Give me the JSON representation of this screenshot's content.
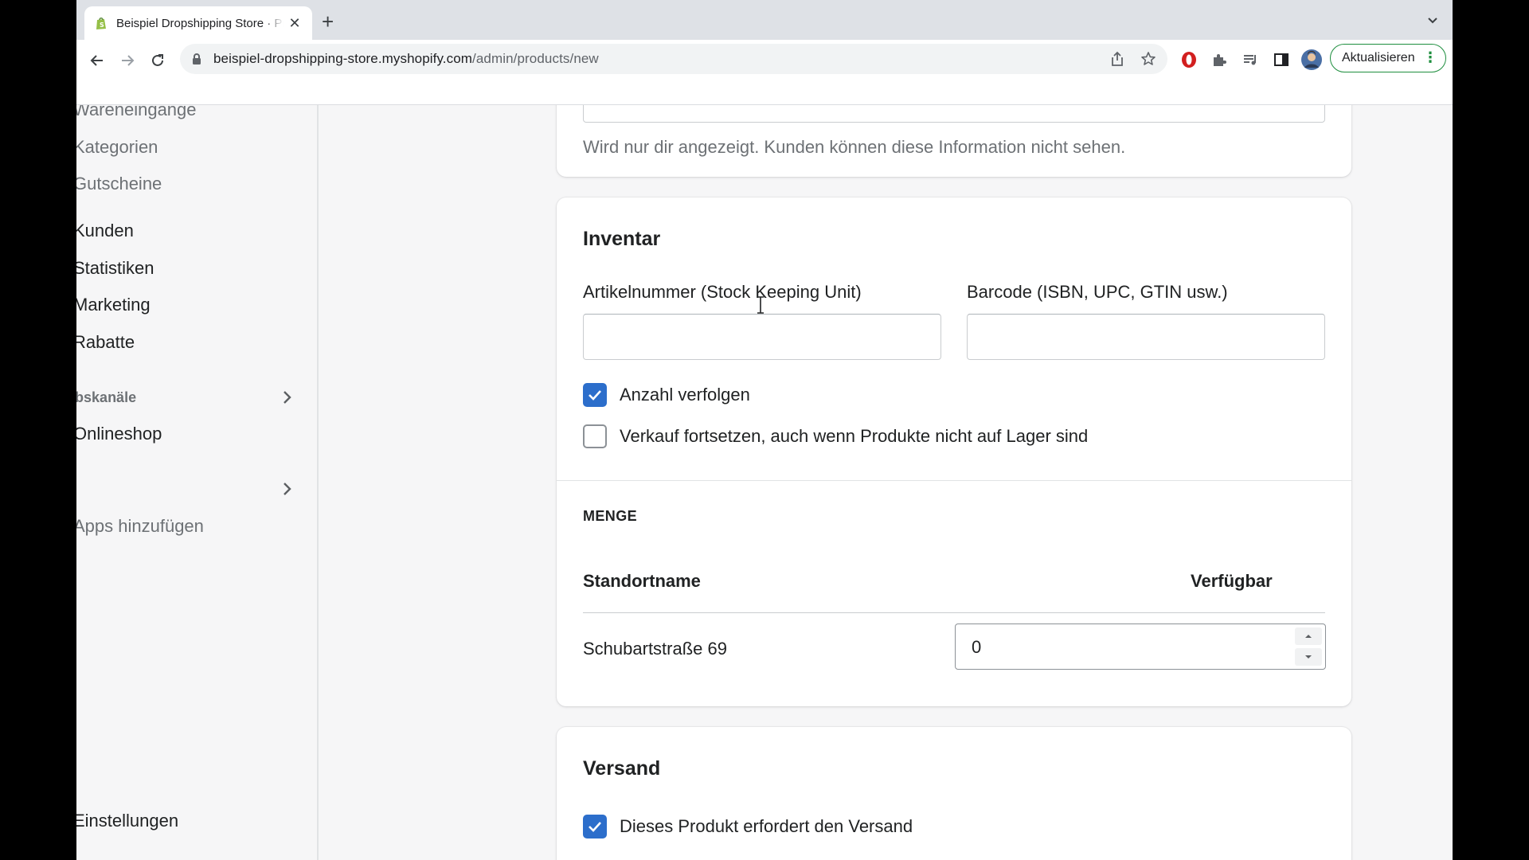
{
  "browser": {
    "tab_title": "Beispiel Dropshipping Store · Produkt hinzufügen",
    "url_host": "beispiel-dropshipping-store.myshopify.com",
    "url_path": "/admin/products/new",
    "update_label": "Aktualisieren",
    "icons": [
      "shopify-favicon",
      "close-icon",
      "plus-icon",
      "chevron-down-icon",
      "back-icon",
      "forward-icon",
      "reload-icon",
      "lock-icon",
      "share-icon",
      "star-icon",
      "opera-icon",
      "extensions-icon",
      "media-icon",
      "side-panel-icon",
      "avatar",
      "more-vert-icon"
    ],
    "accent": "#1e8e3e"
  },
  "sidebar": {
    "items": {
      "wareneingaenge": "Wareneingänge",
      "kategorien": "Kategorien",
      "gutscheine": "Gutscheine",
      "kunden": "Kunden",
      "statistiken": "Statistiken",
      "marketing": "Marketing",
      "rabatte": "Rabatte",
      "vertriebskanaele": "Vertriebskanäle",
      "onlineshop": "Onlineshop",
      "apps_add": "Apps hinzufügen",
      "einstellungen": "Einstellungen"
    }
  },
  "note_card": {
    "help_text": "Wird nur dir angezeigt. Kunden können diese Information nicht sehen."
  },
  "inventory": {
    "title": "Inventar",
    "sku_label": "Artikelnummer (Stock Keeping Unit)",
    "sku_value": "",
    "barcode_label": "Barcode (ISBN, UPC, GTIN usw.)",
    "barcode_value": "",
    "track_quantity_label": "Anzahl verfolgen",
    "track_quantity_checked": true,
    "continue_selling_label": "Verkauf fortsetzen, auch wenn Produkte nicht auf Lager sind",
    "continue_selling_checked": false,
    "quantity_heading": "MENGE",
    "col_location": "Standortname",
    "col_available": "Verfügbar",
    "location_name": "Schubartstraße 69",
    "available_value": "0"
  },
  "shipping": {
    "title": "Versand",
    "requires_shipping_label": "Dieses Produkt erfordert den Versand",
    "requires_shipping_checked": true
  },
  "colors": {
    "checkbox_blue": "#2c6ecb",
    "page_bg": "#f6f6f7"
  }
}
